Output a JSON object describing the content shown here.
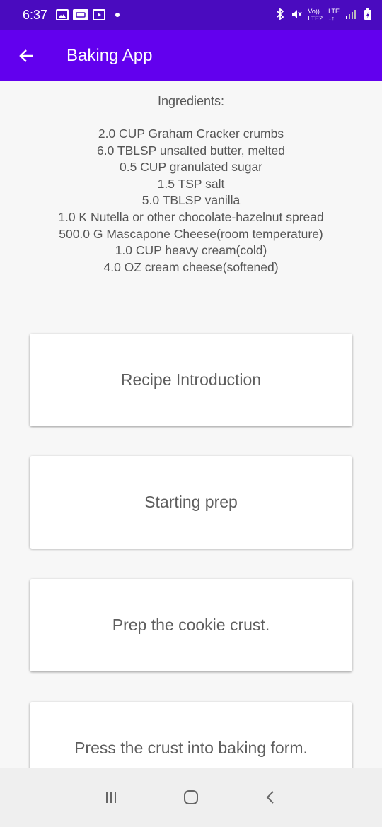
{
  "status_bar": {
    "time": "6:37",
    "left_icons": [
      "image-icon",
      "app-icon",
      "media-icon",
      "notification-dot"
    ],
    "right_icons": [
      "bluetooth-icon",
      "mute-icon",
      "volte-icon",
      "lte-icon",
      "signal-icon",
      "battery-icon"
    ],
    "volte_label": "Vo))",
    "lte_label": "LTE",
    "lte2_label": "LTE2"
  },
  "app_bar": {
    "title": "Baking App",
    "background": "#6200ee"
  },
  "ingredients": {
    "heading": "Ingredients:",
    "items": [
      "2.0 CUP Graham Cracker crumbs",
      "6.0 TBLSP unsalted butter, melted",
      "0.5 CUP granulated sugar",
      "1.5 TSP salt",
      "5.0 TBLSP vanilla",
      "1.0 K Nutella or other chocolate-hazelnut spread",
      "500.0 G Mascapone Cheese(room temperature)",
      "1.0 CUP heavy cream(cold)",
      "4.0 OZ cream cheese(softened)"
    ]
  },
  "steps": [
    {
      "label": "Recipe Introduction"
    },
    {
      "label": "Starting prep"
    },
    {
      "label": "Prep the cookie crust."
    },
    {
      "label": "Press the crust into baking form."
    }
  ],
  "nav_bar": {
    "buttons": [
      "recent-apps-icon",
      "home-icon",
      "back-icon"
    ]
  }
}
